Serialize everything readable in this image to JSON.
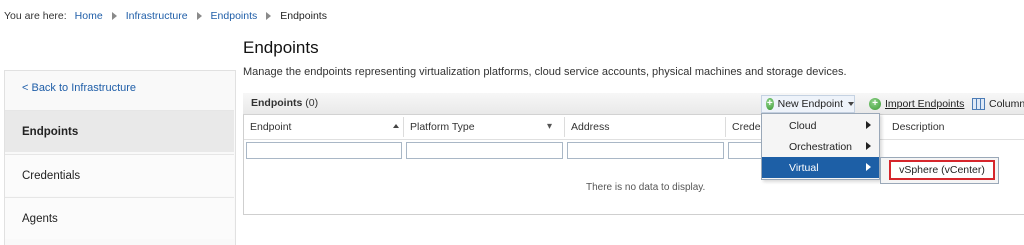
{
  "breadcrumb": {
    "prefix": "You are here:",
    "items": [
      "Home",
      "Infrastructure",
      "Endpoints",
      "Endpoints"
    ]
  },
  "page": {
    "title": "Endpoints",
    "description": "Manage the endpoints representing virtualization platforms, cloud service accounts, physical machines and storage devices."
  },
  "sidebar": {
    "back_label": "< Back to Infrastructure",
    "items": [
      {
        "label": "Endpoints",
        "selected": true
      },
      {
        "label": "Credentials",
        "selected": false
      },
      {
        "label": "Agents",
        "selected": false
      }
    ]
  },
  "grid": {
    "caption": "Endpoints",
    "count": "(0)",
    "columns": [
      "Endpoint",
      "Platform Type",
      "Address",
      "Creden",
      "Description"
    ],
    "empty_message": "There is no data to display."
  },
  "toolbar": {
    "new_endpoint": "New Endpoint",
    "import_endpoints": "Import Endpoints",
    "columns": "Columns"
  },
  "menu": {
    "items": [
      {
        "label": "Cloud",
        "active": false
      },
      {
        "label": "Orchestration",
        "active": false
      },
      {
        "label": "Virtual",
        "active": true
      }
    ],
    "submenu": [
      "vSphere (vCenter)"
    ]
  },
  "colors": {
    "link": "#1f5ea8",
    "menu_active": "#1d5fa6",
    "highlight_border": "#d6262c"
  }
}
